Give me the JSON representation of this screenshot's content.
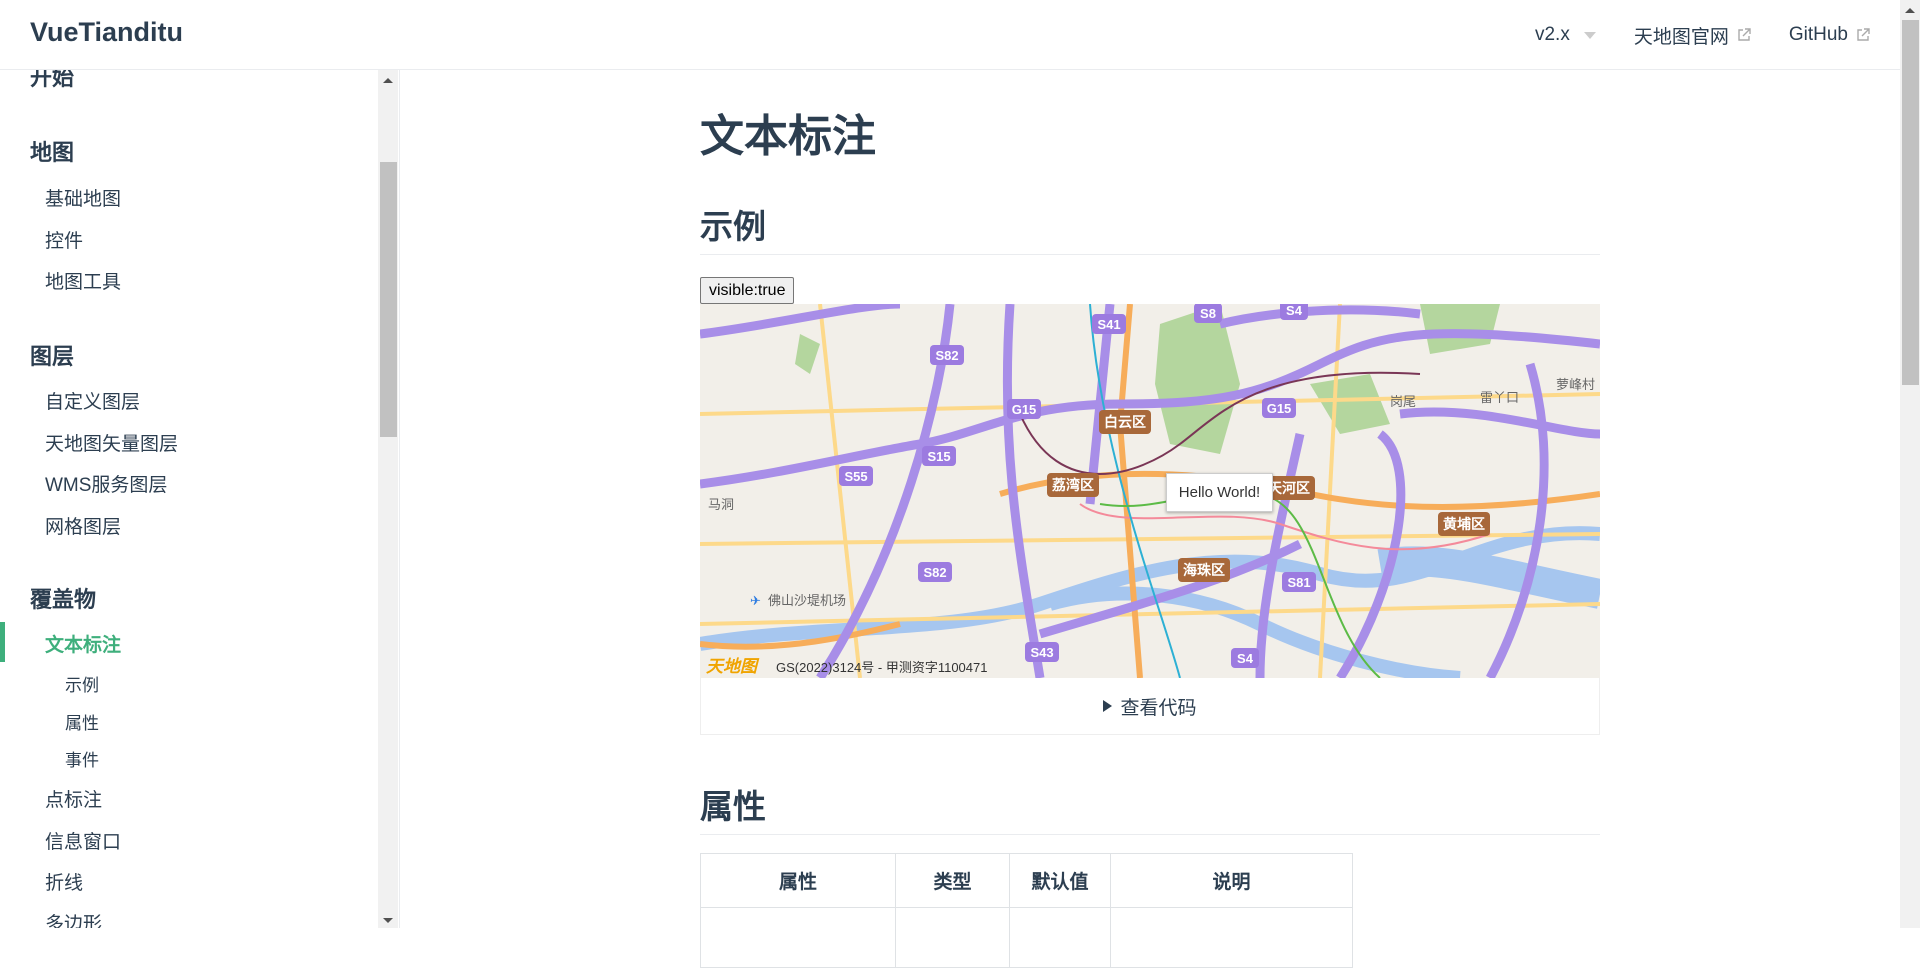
{
  "header": {
    "logo": "VueTianditu",
    "nav": [
      {
        "label": "v2.x"
      },
      {
        "label": "天地图官网"
      },
      {
        "label": "GitHub"
      }
    ]
  },
  "sidebar": {
    "groups": [
      "开始",
      "地图",
      "图层",
      "覆盖物"
    ],
    "map_items": [
      "基础地图",
      "控件",
      "地图工具"
    ],
    "layer_items": [
      "自定义图层",
      "天地图矢量图层",
      "WMS服务图层",
      "网格图层"
    ],
    "overlay_items": [
      "文本标注",
      "点标注",
      "信息窗口",
      "折线",
      "多边形"
    ],
    "active_subitems": [
      "示例",
      "属性",
      "事件"
    ]
  },
  "main": {
    "title": "文本标注",
    "example_heading": "示例",
    "visible_button": "visible:true",
    "map": {
      "label_text": "Hello World!",
      "attribution": "GS(2022)3124号 - 甲测资字1100471",
      "logo": "天地图",
      "road_shields": [
        "S41",
        "S8",
        "S4",
        "S82",
        "G15",
        "G15",
        "S15",
        "S55",
        "S82",
        "S81",
        "S43",
        "S4"
      ],
      "districts": [
        "白云区",
        "荔湾区",
        "天河区",
        "黄埔区",
        "海珠区"
      ],
      "places": [
        "马洞",
        "佛山沙堤机场",
        "岗尾",
        "雷丫口",
        "萝峰村"
      ]
    },
    "view_code": "查看代码",
    "props_heading": "属性",
    "table": {
      "headers": [
        "属性",
        "类型",
        "默认值",
        "说明"
      ]
    }
  },
  "colors": {
    "accent": "#3eaf7c",
    "text": "#2c3e50",
    "highway": "#a88ee8",
    "district": "#a8683a"
  }
}
